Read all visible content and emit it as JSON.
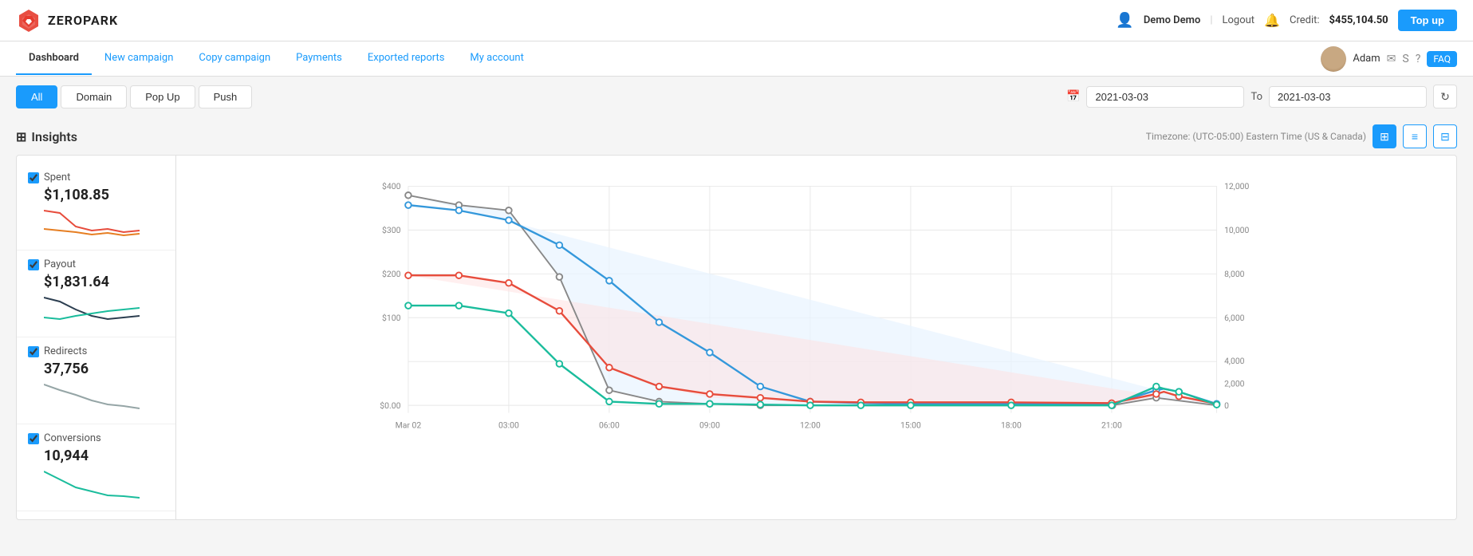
{
  "header": {
    "logo_text": "ZEROPARK",
    "user_name": "Demo Demo",
    "logout_label": "Logout",
    "credit_label": "Credit:",
    "credit_amount": "$455,104.50",
    "topup_label": "Top up"
  },
  "nav": {
    "items": [
      {
        "label": "Dashboard",
        "active": true
      },
      {
        "label": "New campaign",
        "active": false
      },
      {
        "label": "Copy campaign",
        "active": false
      },
      {
        "label": "Payments",
        "active": false
      },
      {
        "label": "Exported reports",
        "active": false
      },
      {
        "label": "My account",
        "active": false
      }
    ],
    "user_name": "Adam",
    "faq_label": "FAQ"
  },
  "toolbar": {
    "tabs": [
      {
        "label": "All",
        "active": true
      },
      {
        "label": "Domain",
        "active": false
      },
      {
        "label": "Pop Up",
        "active": false
      },
      {
        "label": "Push",
        "active": false
      }
    ],
    "date_from": "2021-03-03",
    "date_to": "2021-03-03",
    "to_label": "To"
  },
  "insights": {
    "title": "Insights",
    "timezone_label": "Timezone: (UTC-05:00) Eastern Time (US & Canada)",
    "metrics": [
      {
        "label": "Spent",
        "value": "$1,108.85",
        "checked": true
      },
      {
        "label": "Payout",
        "value": "$1,831.64",
        "checked": true
      },
      {
        "label": "Redirects",
        "value": "37,756",
        "checked": true
      },
      {
        "label": "Conversions",
        "value": "10,944",
        "checked": true
      }
    ],
    "chart": {
      "x_labels": [
        "Mar 02",
        "03:00",
        "06:00",
        "09:00",
        "12:00",
        "15:00",
        "18:00",
        "21:00"
      ],
      "y_left_labels": [
        "$400",
        "$300",
        "$200",
        "$100",
        "$0.00"
      ],
      "y_right_labels": [
        "12,000",
        "10,000",
        "8,000",
        "6,000",
        "4,000",
        "2,000",
        "0"
      ]
    }
  }
}
